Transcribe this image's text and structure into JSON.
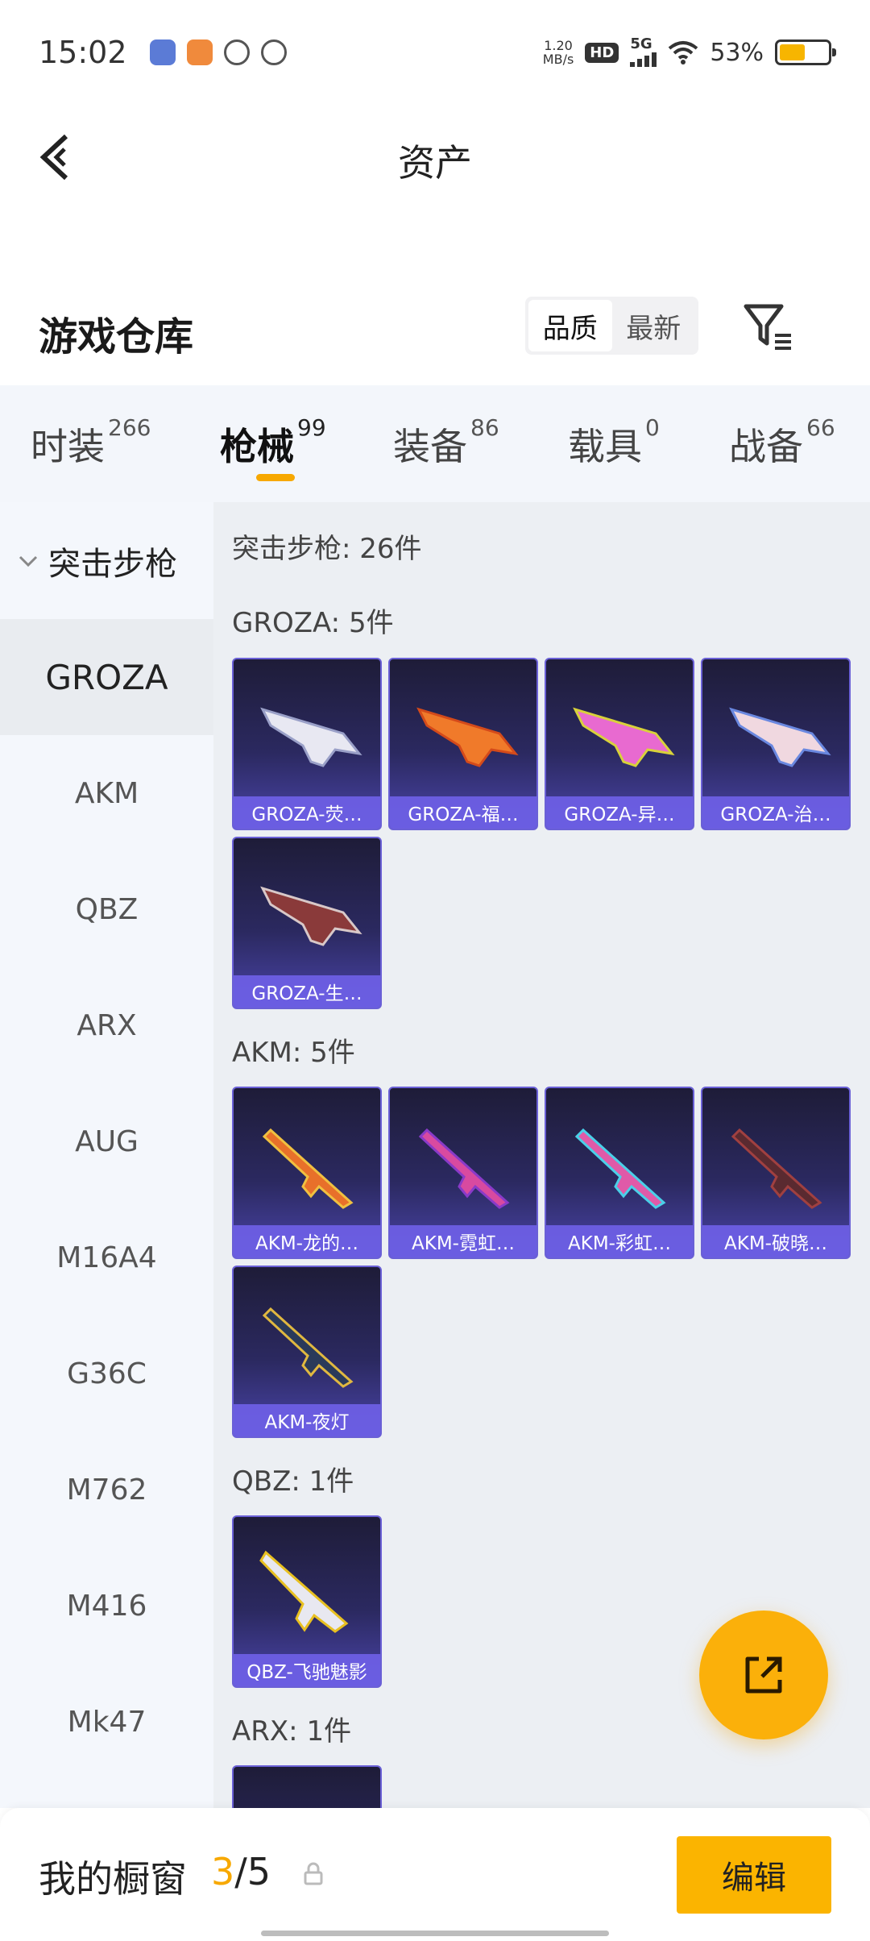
{
  "status_bar": {
    "time": "15:02",
    "net_speed_value": "1.20",
    "net_speed_unit": "MB/s",
    "hd_badge": "HD",
    "network": "5G",
    "battery_text": "53%",
    "battery_level": 0.53
  },
  "header": {
    "title": "资产"
  },
  "warehouse": {
    "title": "游戏仓库",
    "sort_options": [
      "品质",
      "最新"
    ],
    "sort_active": "品质"
  },
  "category_tabs": [
    {
      "label": "时装",
      "count": "266"
    },
    {
      "label": "枪械",
      "count": "99",
      "active": true
    },
    {
      "label": "装备",
      "count": "86"
    },
    {
      "label": "载具",
      "count": "0"
    },
    {
      "label": "战备",
      "count": "66"
    }
  ],
  "left_nav": {
    "group": "突击步枪",
    "items": [
      "GROZA",
      "AKM",
      "QBZ",
      "ARX",
      "AUG",
      "M16A4",
      "G36C",
      "M762",
      "M416",
      "Mk47"
    ],
    "active": "GROZA"
  },
  "content": {
    "summary": "突击步枪: 26件",
    "sections": [
      {
        "title": "GROZA: 5件",
        "items": [
          "GROZA-荧…",
          "GROZA-福…",
          "GROZA-异…",
          "GROZA-治…",
          "GROZA-生…"
        ]
      },
      {
        "title": "AKM: 5件",
        "items": [
          "AKM-龙的…",
          "AKM-霓虹…",
          "AKM-彩虹…",
          "AKM-破晓…",
          "AKM-夜灯"
        ]
      },
      {
        "title": "QBZ: 1件",
        "items": [
          "QBZ-飞驰魅影"
        ]
      },
      {
        "title": "ARX: 1件",
        "items": [
          ""
        ]
      }
    ]
  },
  "bottom_bar": {
    "showcase_label": "我的橱窗",
    "showcase_current": "3",
    "showcase_total": "/5",
    "edit_label": "编辑"
  },
  "colors": {
    "accent": "#f7a800",
    "card_label": "#6e5fe6",
    "card_bg": "#2b2960"
  },
  "icons": [
    "back-arrow-icon",
    "filter-icon",
    "chevron-down-icon",
    "share-icon",
    "lock-icon"
  ]
}
